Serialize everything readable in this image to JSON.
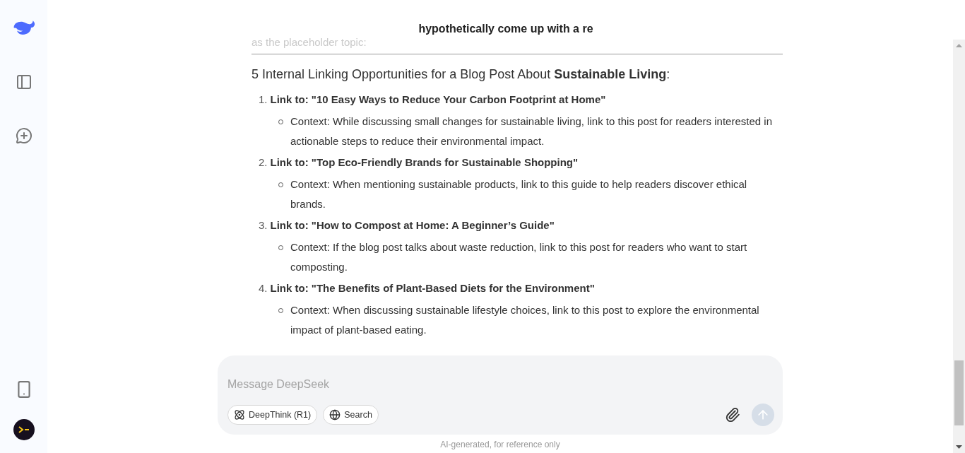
{
  "header": {
    "title": "hypothetically come up with a re"
  },
  "message": {
    "faded_line": "as the placeholder topic:",
    "heading": "5 Internal Linking Opportunities for a Blog Post About **Sustainable Living**:",
    "items": [
      {
        "number": "1.",
        "title": "Link to: \"10 Easy Ways to Reduce Your Carbon Footprint at Home\"",
        "points": [
          "Context: While discussing small changes for sustainable living, link to this post for readers interested in actionable steps to reduce their environmental impact."
        ]
      },
      {
        "number": "2.",
        "title": "Link to: \"Top Eco-Friendly Brands for Sustainable Shopping\"",
        "points": [
          "Context: When mentioning sustainable products, link to this guide to help readers discover ethical brands."
        ]
      },
      {
        "number": "3.",
        "title": "Link to: \"How to Compost at Home: A Beginner’s Guide\"",
        "points": [
          "Context: If the blog post talks about waste reduction, link to this post for readers who want to start composting."
        ]
      },
      {
        "number": "4.",
        "title": "Link to: \"The Benefits of Plant-Based Diets for the Environment\"",
        "points": [
          "Context: When discussing sustainable lifestyle choices, link to this post to explore the environmental impact of plant-based eating."
        ]
      }
    ]
  },
  "composer": {
    "placeholder": "Message DeepSeek",
    "toggles": [
      {
        "kind": "deepthink",
        "label": "DeepThink (R1)",
        "selected": false
      },
      {
        "kind": "search",
        "label": "Search",
        "selected": false
      }
    ],
    "send_disabled": true
  },
  "footer_note": "AI-generated, for reference only"
}
